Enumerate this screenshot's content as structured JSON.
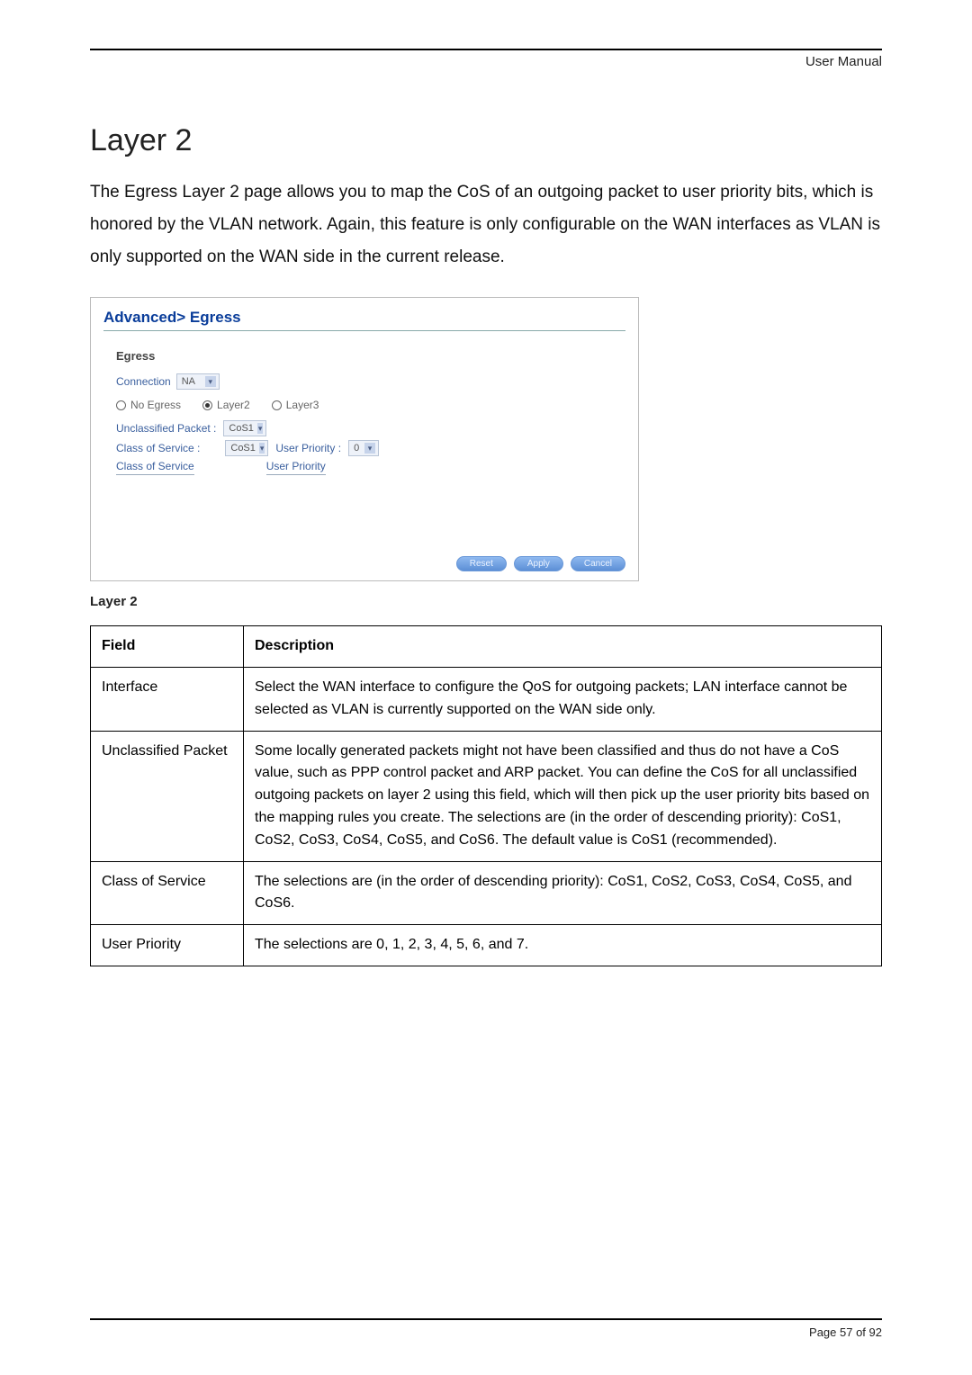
{
  "header": {
    "right": "User Manual"
  },
  "section": {
    "title": "Layer 2",
    "paragraph": "The Egress Layer 2 page allows you to map the CoS of an outgoing packet to user priority bits, which is honored by the VLAN network. Again, this feature is only configurable on the WAN interfaces as VLAN is only supported on the WAN side in the current release."
  },
  "shot": {
    "breadcrumb": "Advanced> Egress",
    "section_label": "Egress",
    "connection": {
      "label": "Connection",
      "value": "NA"
    },
    "modes": {
      "no_egress": "No Egress",
      "layer2": "Layer2",
      "layer3": "Layer3",
      "selected": "layer2"
    },
    "unclassified": {
      "label": "Unclassified Packet :",
      "value": "CoS1"
    },
    "cos_row": {
      "label": "Class of Service :",
      "cos_value": "CoS1",
      "up_label": "User Priority :",
      "up_value": "0"
    },
    "table_heads": {
      "cos": "Class of Service",
      "up": "User Priority"
    },
    "buttons": {
      "reset": "Reset",
      "apply": "Apply",
      "cancel": "Cancel"
    }
  },
  "caption": "Layer 2",
  "table": {
    "head": {
      "field": "Field",
      "desc": "Description"
    },
    "rows": [
      {
        "field": "Interface",
        "desc": "Select the WAN interface to configure the QoS for outgoing packets; LAN interface cannot be selected as VLAN is currently supported on the WAN side only."
      },
      {
        "field": "Unclassified Packet",
        "desc": "Some locally generated packets might not have been classified and thus do not have a CoS value, such as PPP control packet and ARP packet. You can define the CoS for all unclassified outgoing packets on layer 2 using this field, which will then pick up the user priority bits based on the mapping rules you create. The selections are (in the order of descending priority): CoS1, CoS2, CoS3, CoS4, CoS5, and CoS6. The default value is CoS1 (recommended)."
      },
      {
        "field": "Class of Service",
        "desc": "The selections are (in the order of descending priority): CoS1, CoS2, CoS3, CoS4, CoS5, and CoS6."
      },
      {
        "field": "User Priority",
        "desc": "The selections are 0, 1, 2, 3, 4, 5, 6, and 7."
      }
    ]
  },
  "footer": {
    "page": "Page 57 of 92"
  }
}
